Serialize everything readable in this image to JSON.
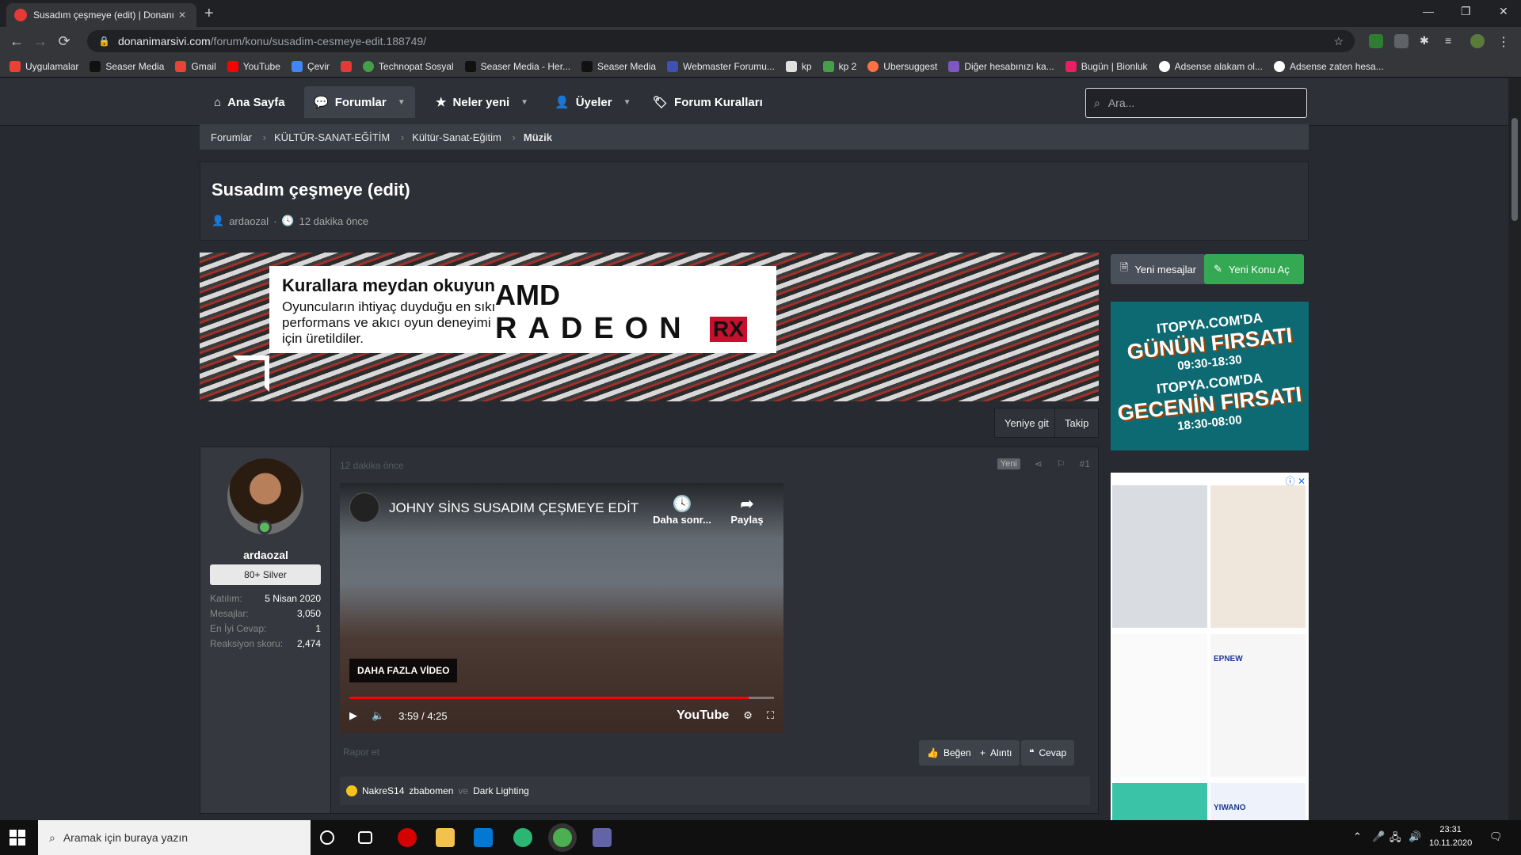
{
  "browser": {
    "tab_title": "Susadım çeşmeye (edit) | Donanı",
    "tab_close": "✕",
    "new_tab": "+",
    "url_host": "donanimarsivi.com",
    "url_path": "/forum/konu/susadim-cesmeye-edit.188749/",
    "window_minimize": "—",
    "window_restore": "❐",
    "window_close": "✕"
  },
  "bookmarks": [
    {
      "label": "Uygulamalar",
      "color": "#e94235"
    },
    {
      "label": "Seaser Media",
      "color": "#202124"
    },
    {
      "label": "Gmail",
      "color": "#ea4335"
    },
    {
      "label": "YouTube",
      "color": "#ff0000"
    },
    {
      "label": "Çevir",
      "color": "#4285f4"
    },
    {
      "label": "",
      "color": "#e53935"
    },
    {
      "label": "Technopat Sosyal",
      "color": "#43a047"
    },
    {
      "label": "Seaser Media - Her...",
      "color": "#202124"
    },
    {
      "label": "Seaser Media",
      "color": "#202124"
    },
    {
      "label": "Webmaster Forumu...",
      "color": "#3f51b5"
    },
    {
      "label": "kp",
      "color": "#e0e0e0"
    },
    {
      "label": "kp 2",
      "color": "#43a047"
    },
    {
      "label": "Ubersuggest",
      "color": "#ff7043"
    },
    {
      "label": "Diğer hesabınızı ka...",
      "color": "#7e57c2"
    },
    {
      "label": "Bugün | Bionluk",
      "color": "#e91e63"
    },
    {
      "label": "Adsense alakam ol...",
      "color": "#ffffff"
    },
    {
      "label": "Adsense zaten hesa...",
      "color": "#ffffff"
    }
  ],
  "site_nav": {
    "home": "Ana Sayfa",
    "forums": "Forumlar",
    "whats_new": "Neler yeni",
    "members": "Üyeler",
    "rules": "Forum Kuralları",
    "search_placeholder": "Ara..."
  },
  "breadcrumb": [
    "Forumlar",
    "KÜLTÜR-SANAT-EĞİTİM",
    "Kültür-Sanat-Eğitim",
    "Müzik"
  ],
  "thread": {
    "title": "Susadım çeşmeye (edit)",
    "author": "ardaozal",
    "time": "12 dakika önce"
  },
  "ads": {
    "amd_headline": "Kurallara meydan okuyun",
    "amd_body": "Oyuncuların ihtiyaç duyduğu en sıkı performans ve akıcı oyun deneyimi için üretildiler.",
    "amd_brand": "AMD",
    "amd_product": "RADEON",
    "amd_rx": "RX",
    "itopya_line1": "ITOPYA.COM'DA",
    "itopya_line2": "GÜNÜN FIRSATI",
    "itopya_line3": "09:30-18:30",
    "itopya_line4": "ITOPYA.COM'DA",
    "itopya_line5": "GECENİN FIRSATI",
    "itopya_line6": "18:30-08:00",
    "product_brand_1": "EPNEW",
    "product_brand_2": "YIWANO"
  },
  "sidebar": {
    "new_posts": "Yeni mesajlar",
    "new_thread": "Yeni Konu Aç"
  },
  "thread_actions": {
    "goto_new": "Yeniye git",
    "follow": "Takip"
  },
  "post": {
    "user": {
      "name": "ardaozal",
      "title": "80+ Silver",
      "stats": [
        {
          "label": "Katılım:",
          "value": "5 Nisan 2020"
        },
        {
          "label": "Mesajlar:",
          "value": "3,050"
        },
        {
          "label": "En İyi Cevap:",
          "value": "1"
        },
        {
          "label": "Reaksiyon skoru:",
          "value": "2,474"
        }
      ]
    },
    "time": "12 dakika önce",
    "new_badge": "Yeni",
    "number": "#1",
    "video": {
      "title": "JOHNY SİNS SUSADIM ÇEŞMEYE EDİT",
      "watch_later": "Daha sonr...",
      "share": "Paylaş",
      "more_videos": "DAHA FAZLA VİDEO",
      "time": "3:59 / 4:25",
      "progress": 0.94,
      "youtube": "YouTube"
    },
    "report": "Rapor et",
    "like": "Beğen",
    "quote": "Alıntı",
    "reply": "Cevap",
    "reactors": [
      "NakreS14",
      "zbabomen"
    ],
    "reactors_and": "ve",
    "reactor_last": "Dark Lighting"
  },
  "taskbar": {
    "search_placeholder": "Aramak için buraya yazın",
    "time": "23:31",
    "date": "10.11.2020"
  }
}
